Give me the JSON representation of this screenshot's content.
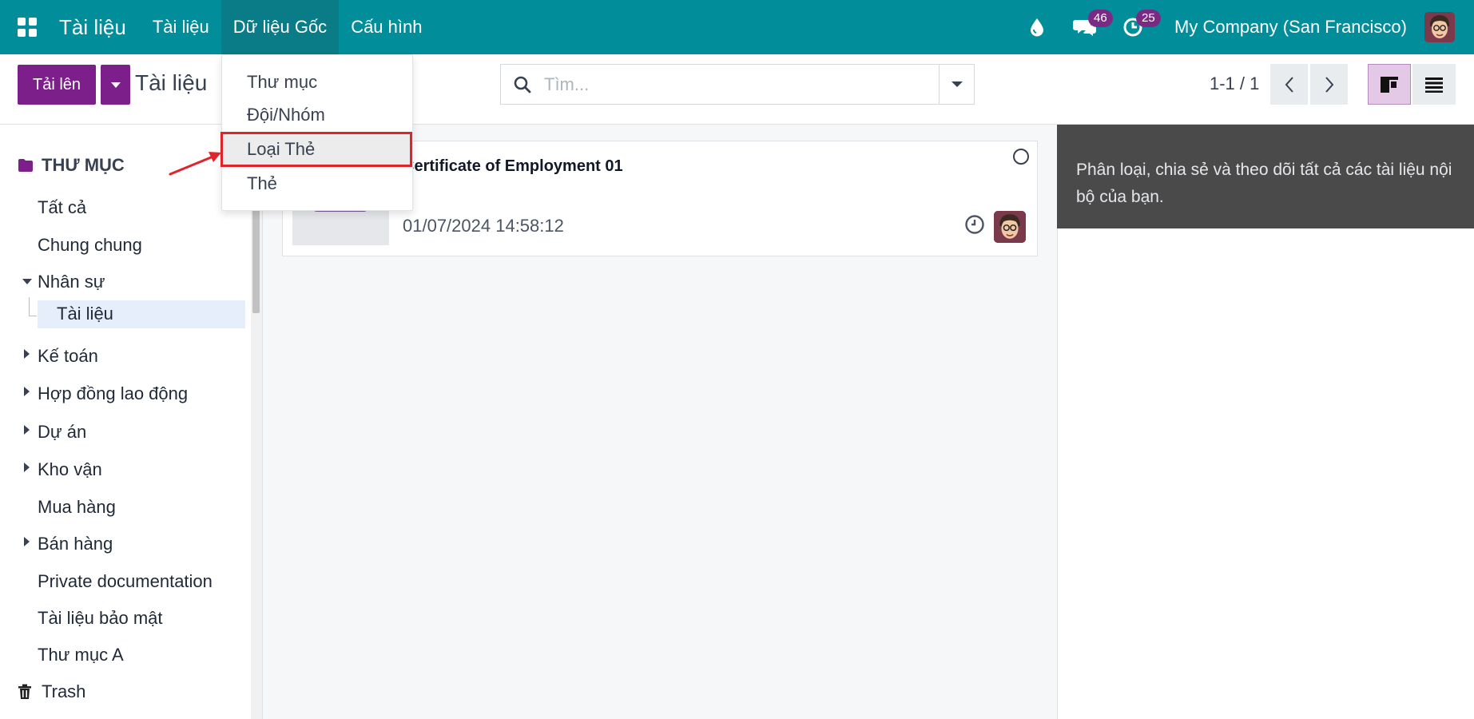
{
  "navbar": {
    "brand": "Tài liệu",
    "menu": [
      "Tài liệu",
      "Dữ liệu Gốc",
      "Cấu hình"
    ],
    "messages_badge": "46",
    "activities_badge": "25",
    "company": "My Company (San Francisco)"
  },
  "control": {
    "upload_label": "Tải lên",
    "breadcrumb": "Tài liệu",
    "search_placeholder": "Tìm...",
    "pager": "1-1 / 1"
  },
  "dropdown": {
    "items": [
      "Thư mục",
      "Đội/Nhóm",
      "Loại Thẻ",
      "Thẻ"
    ],
    "highlighted": "Loại Thẻ"
  },
  "sidebar": {
    "header": "THƯ MỤC",
    "items": [
      "Tất cả",
      "Chung chung",
      "Nhân sự",
      "Tài liệu",
      "Kế toán",
      "Hợp đồng lao động",
      "Dự án",
      "Kho vận",
      "Mua hàng",
      "Bán hàng",
      "Private documentation",
      "Tài liệu bảo mật",
      "Thư mục A",
      "Trash"
    ]
  },
  "card": {
    "title": "Certificate of Employment 01",
    "date": "01/07/2024 14:58:12"
  },
  "help": {
    "text": "Phân loại, chia sẻ và theo dõi tất cả các tài liệu nội bộ của bạn."
  },
  "colors": {
    "navbar": "#018d9a",
    "primary": "#7c1f8a",
    "highlight": "#e0242b"
  }
}
